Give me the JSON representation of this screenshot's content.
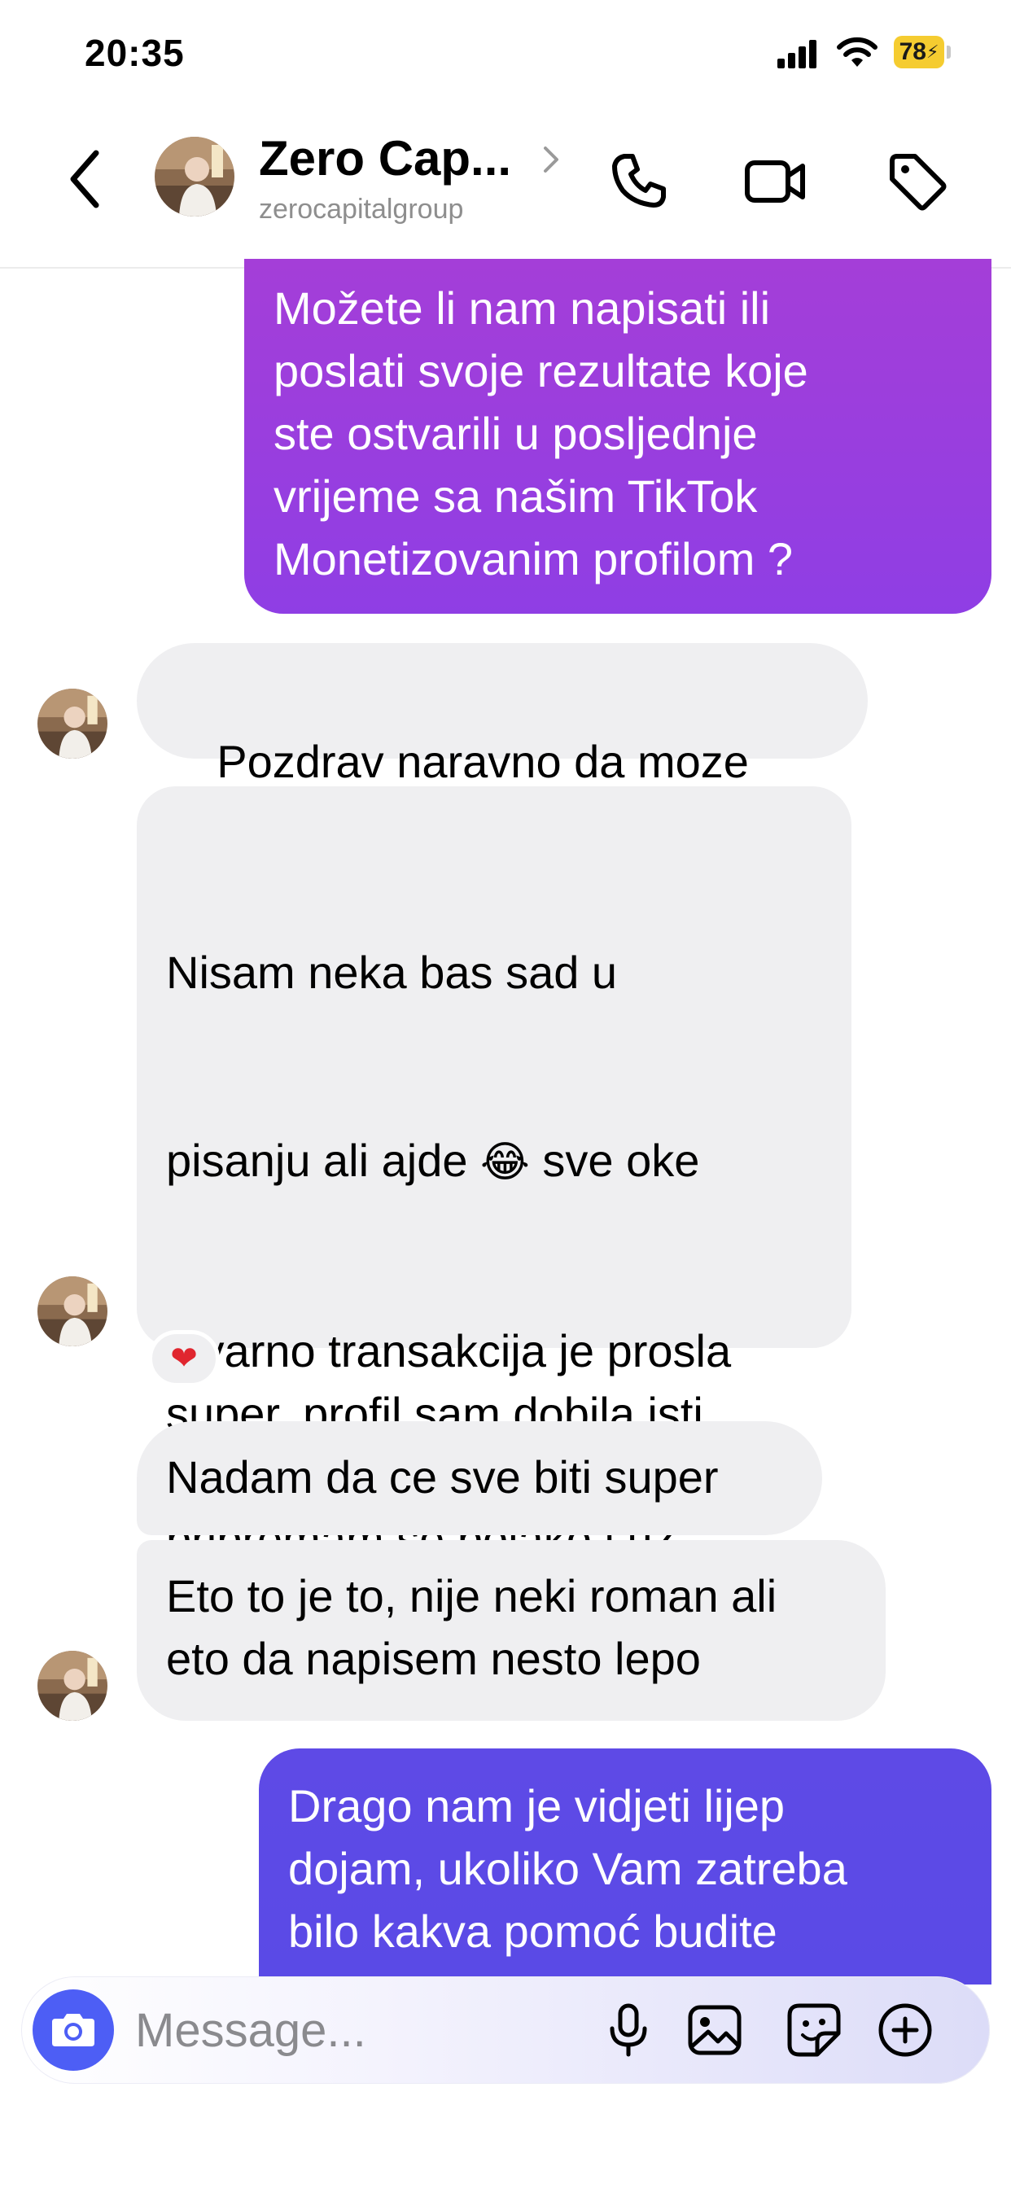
{
  "status_bar": {
    "time": "20:35",
    "battery": "78",
    "icons": [
      "cellular-signal-icon",
      "wifi-icon",
      "battery-charging-icon"
    ]
  },
  "header": {
    "contact_name": "Zero Cap...",
    "handle": "zerocapitalgroup",
    "icons": [
      "back-chevron-icon",
      "phone-icon",
      "video-camera-icon",
      "tag-icon"
    ]
  },
  "messages": [
    {
      "direction": "outgoing",
      "text": "Možete li nam napisati ili\nposlati svoje rezultate koje\nste ostvarili u posljednje\nvrijeme sa našim TikTok\nMonetizovanim profilom ?"
    },
    {
      "direction": "incoming",
      "text": "Pozdrav naravno da moze",
      "emoji": "😝"
    },
    {
      "direction": "incoming",
      "line1": "Nisam neka bas sad u",
      "line2_before": "pisanju ali ajde",
      "line2_emoji": "😂",
      "line2_after": "sve oke",
      "rest": "stvarno transakcija je prosla\nsuper, profil sam dobila isti\ndan, citam trenutno ebook\npripremam se polako i uz\npomoc Boziju krecem\nsledece nedjelje",
      "reaction": "❤"
    },
    {
      "direction": "incoming",
      "text": "Nadam da ce sve biti super"
    },
    {
      "direction": "incoming",
      "text": "Eto to je to, nije neki roman ali\neto da napisem nesto lepo"
    },
    {
      "direction": "outgoing",
      "text": "Drago nam je vidjeti lijep\ndojam, ukoliko Vam zatreba\nbilo kakva pomoć budite"
    }
  ],
  "composer": {
    "placeholder": "Message...",
    "icons": [
      "camera-icon",
      "microphone-icon",
      "gallery-icon",
      "sticker-icon",
      "add-icon"
    ]
  },
  "colors": {
    "incoming_bubble": "#efeff1",
    "outgoing_gradient_top": "#a43ed8",
    "outgoing_gradient_bottom": "#8a3ee6",
    "outgoing_blue": "#5a4ae6",
    "accent_camera": "#4d5ef5",
    "battery": "#f5cc30"
  }
}
